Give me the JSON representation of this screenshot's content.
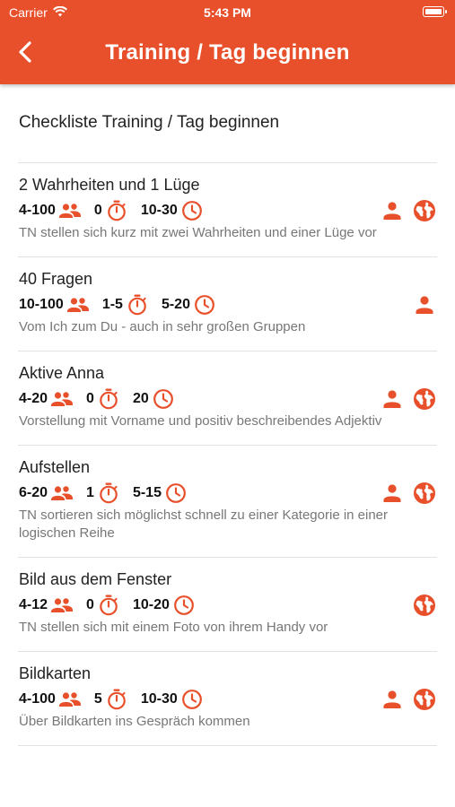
{
  "status": {
    "carrier": "Carrier",
    "time": "5:43 PM"
  },
  "nav": {
    "title": "Training / Tag beginnen"
  },
  "section": {
    "title": "Checkliste Training / Tag beginnen"
  },
  "colors": {
    "accent": "#e8502b",
    "text": "#222222",
    "muted": "#777777"
  },
  "items": [
    {
      "title": "2 Wahrheiten und 1 Lüge",
      "participants": "4-100",
      "prep": "0",
      "duration": "10-30",
      "person": true,
      "globe": true,
      "description": "TN stellen sich kurz mit zwei Wahrheiten und einer Lüge vor"
    },
    {
      "title": "40 Fragen",
      "participants": "10-100",
      "prep": "1-5",
      "duration": "5-20",
      "person": true,
      "globe": false,
      "description": "Vom Ich zum Du - auch in sehr großen Gruppen"
    },
    {
      "title": "Aktive Anna",
      "participants": "4-20",
      "prep": "0",
      "duration": "20",
      "person": true,
      "globe": true,
      "description": "Vorstellung mit Vorname und positiv beschreibendes Adjektiv"
    },
    {
      "title": "Aufstellen",
      "participants": "6-20",
      "prep": "1",
      "duration": "5-15",
      "person": true,
      "globe": true,
      "description": "TN sortieren sich möglichst schnell zu einer Kategorie in einer logischen Reihe"
    },
    {
      "title": "Bild aus dem Fenster",
      "participants": "4-12",
      "prep": "0",
      "duration": "10-20",
      "person": false,
      "globe": true,
      "description": "TN stellen sich mit einem Foto von ihrem Handy vor"
    },
    {
      "title": "Bildkarten",
      "participants": "4-100",
      "prep": "5",
      "duration": "10-30",
      "person": true,
      "globe": true,
      "description": "Über Bildkarten ins Gespräch kommen"
    }
  ]
}
